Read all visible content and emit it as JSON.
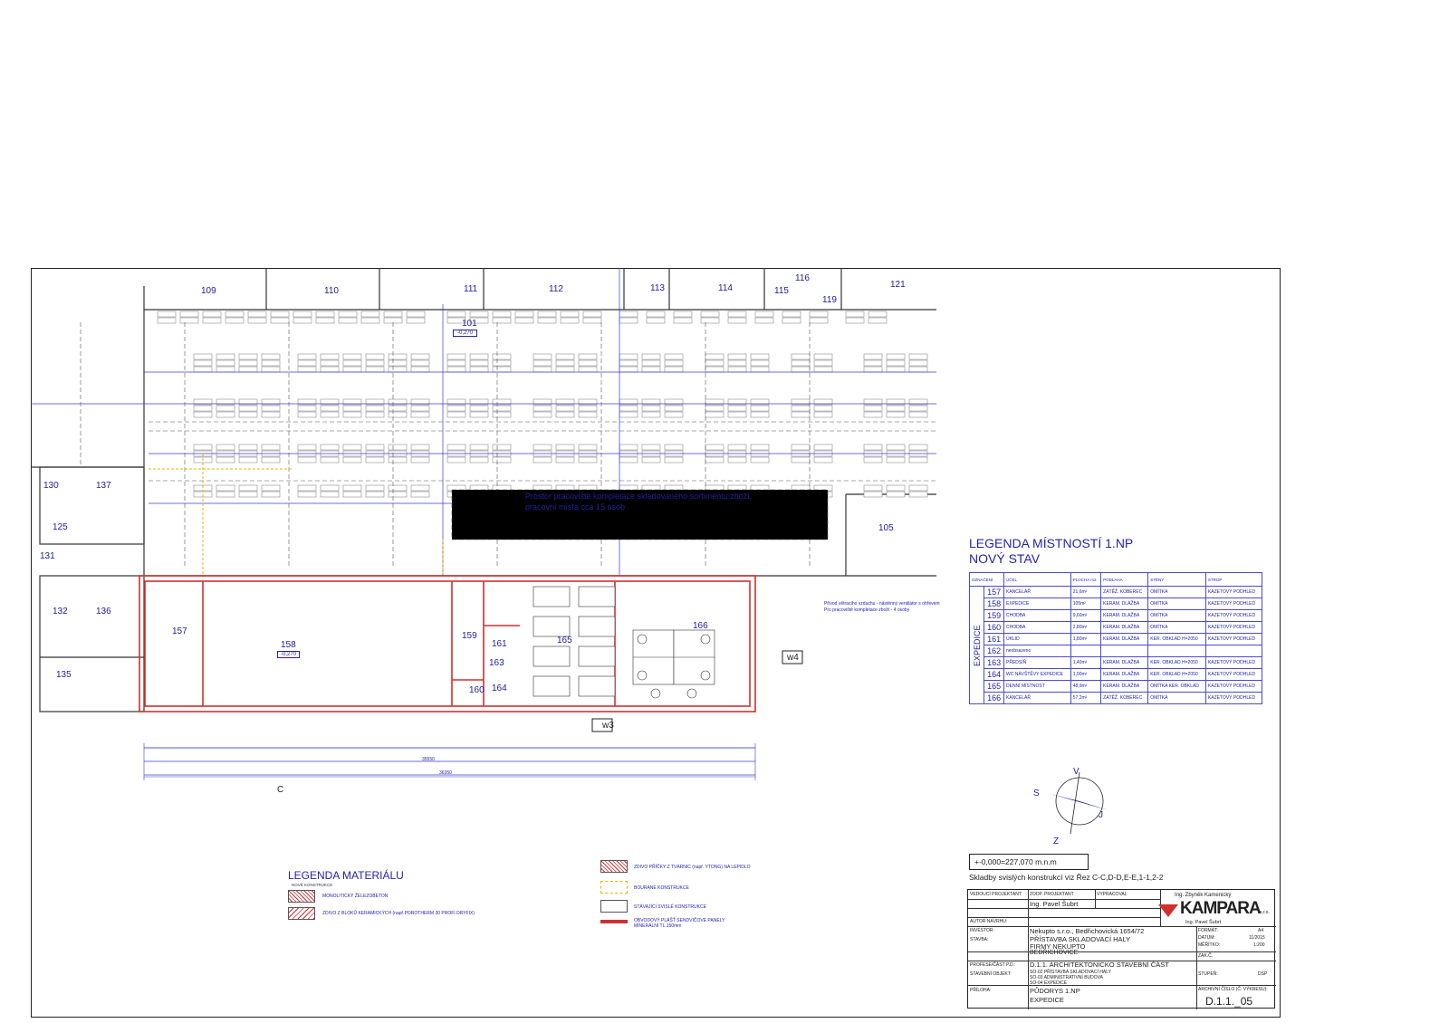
{
  "rooms_plan": [
    {
      "id": "r109",
      "label": "109"
    },
    {
      "id": "r110",
      "label": "110"
    },
    {
      "id": "r111",
      "label": "111"
    },
    {
      "id": "r112",
      "label": "112"
    },
    {
      "id": "r113",
      "label": "113"
    },
    {
      "id": "r114",
      "label": "114"
    },
    {
      "id": "r115",
      "label": "115"
    },
    {
      "id": "r116",
      "label": "116"
    },
    {
      "id": "r119",
      "label": "119"
    },
    {
      "id": "r121",
      "label": "121"
    },
    {
      "id": "r101",
      "label": "101"
    },
    {
      "id": "r105",
      "label": "105"
    },
    {
      "id": "r130",
      "label": "130"
    },
    {
      "id": "r137",
      "label": "137"
    },
    {
      "id": "r125",
      "label": "125"
    },
    {
      "id": "r131",
      "label": "131"
    },
    {
      "id": "r132",
      "label": "132"
    },
    {
      "id": "r136",
      "label": "136"
    },
    {
      "id": "r135",
      "label": "135"
    },
    {
      "id": "r157",
      "label": "157"
    },
    {
      "id": "r158",
      "label": "158"
    },
    {
      "id": "r159",
      "label": "159"
    },
    {
      "id": "r160",
      "label": "160"
    },
    {
      "id": "r161",
      "label": "161"
    },
    {
      "id": "r163",
      "label": "163"
    },
    {
      "id": "r164",
      "label": "164"
    },
    {
      "id": "r165",
      "label": "165"
    },
    {
      "id": "r166",
      "label": "166"
    }
  ],
  "plan_text": {
    "workspace_note_1": "Prostor pracoviště kompletace skladovaného sortimentu zboží,",
    "workspace_note_2": "pracovní místa cca 15 osob",
    "level_101": "-0,270",
    "level_158": "-0,270",
    "axis_c": "C",
    "tag_w3": "w3",
    "tag_w4": "w4",
    "dim_total": "36350",
    "dim_sub": "35550",
    "vent_note_1": "Přívod větracího vzduchu - nástěnný ventilátor s ohřevem",
    "vent_note_2": "Pro pracoviště kompletace zboží - 4 osoby"
  },
  "room_legend": {
    "title_1": "LEGENDA MÍSTNOSTÍ 1.NP",
    "title_2": "NOVÝ STAV",
    "headers": [
      "OZNAČENÍ",
      "ÚČEL",
      "PLOCHA m2",
      "PODLAHA",
      "STĚNY",
      "STROP"
    ],
    "group": "EXPEDICE",
    "rows": [
      {
        "num": "157",
        "use": "KANCELÁŘ",
        "area": "21,6m²",
        "floor": "ZÁTĚŽ. KOBEREC",
        "walls": "OMÍTKA",
        "ceiling": "KAZETOVÝ PODHLED"
      },
      {
        "num": "158",
        "use": "EXPEDICE",
        "area": "105m²",
        "floor": "KERAM. DLAŽBA",
        "walls": "OMÍTKA",
        "ceiling": "KAZETOVÝ PODHLED"
      },
      {
        "num": "159",
        "use": "CHODBA",
        "area": "9,60m²",
        "floor": "KERAM. DLAŽBA",
        "walls": "OMÍTKA",
        "ceiling": "KAZETOVÝ PODHLED"
      },
      {
        "num": "160",
        "use": "CHODBA",
        "area": "2,80m²",
        "floor": "KERAM. DLAŽBA",
        "walls": "OMÍTKA",
        "ceiling": "KAZETOVÝ PODHLED"
      },
      {
        "num": "161",
        "use": "ÚKLID",
        "area": "1,80m²",
        "floor": "KERAM. DLAŽBA",
        "walls": "KER. OBKLAD H=2050",
        "ceiling": "KAZETOVÝ PODHLED"
      },
      {
        "num": "162",
        "use": "neobsazeno",
        "area": "",
        "floor": "",
        "walls": "",
        "ceiling": ""
      },
      {
        "num": "163",
        "use": "PŘEDSÍŇ",
        "area": "1,40m²",
        "floor": "KERAM. DLAŽBA",
        "walls": "KER. OBKLAD H=2050",
        "ceiling": "KAZETOVÝ PODHLED"
      },
      {
        "num": "164",
        "use": "WC NÁVŠTĚVY EXPEDICE",
        "area": "1,90m²",
        "floor": "KERAM. DLAŽBA",
        "walls": "KER. OBKLAD H=2050",
        "ceiling": "KAZETOVÝ PODHLED"
      },
      {
        "num": "165",
        "use": "DENNÍ MÍSTNOST",
        "area": "48,9m²",
        "floor": "KERAM. DLAŽBA",
        "walls": "OMÍTKA KER. OBKLAD",
        "ceiling": "KAZETOVÝ PODHLED"
      },
      {
        "num": "166",
        "use": "KANCELÁŘ",
        "area": "57,2m²",
        "floor": "ZÁTĚŽ. KOBEREC",
        "walls": "OMÍTKA",
        "ceiling": "KAZETOVÝ PODHLED"
      }
    ]
  },
  "compass": {
    "n": "V",
    "s": "Z",
    "w": "S",
    "e": "J"
  },
  "elevation": "+-0,000=227,070 m.n.m",
  "sections_note": "Skladby svislých konstrukcí viz Řez C-C,D-D,E-E,1-1,2-2",
  "material_legend": {
    "title": "LEGENDA MATERIÁLU",
    "subtitle": "NOVÉ KONSTRUKCE",
    "items": [
      {
        "label": "MONOLITICKÝ ŽELEZOBETON"
      },
      {
        "label": "ZDIVO Z BLOKŮ KERAMICKÝCH (např.POROTHERM 30 PROFI DRYFIX)"
      },
      {
        "label": "ZDIVO PŘÍČKY Z TVÁRNIC (např. YTONG) NA LEPIDLO"
      },
      {
        "label": "BOURANÉ KONSTRUKCE"
      },
      {
        "label": "STÁVAJÍCÍ SVISLÉ KONSTRUKCE"
      },
      {
        "label": "OBVODOVÝ PLÁŠŤ SENDVIČOVÉ PANELY MINERÁLNÍ TL.150mm"
      }
    ]
  },
  "title_block": {
    "lead_designer": "VEDOUCÍ PROJEKTANT",
    "resp_designer": "ZODP. PROJEKTANT",
    "resp_name": "Ing. Pavel Šubrt",
    "drawn": "VYPRACOVAL",
    "author": "AUTOR NÁVRHU:",
    "investor_lbl": "INVESTOR:",
    "investor": "Nekupto s.r.o., Bedřichovická 1654/72",
    "build_lbl": "STAVBA:",
    "build_1": "PŘÍSTAVBA SKLADOVACÍ HALY",
    "build_2": "FIRMY NEKUPTO",
    "build_3": "BEDŘICHOVICE",
    "part_lbl": "PROFESE/ČÁST P.D.:",
    "part": "D.1.1. ARCHITEKTONICKO STAVEBNÍ ČÁST",
    "object_lbl": "STAVEBNÍ OBJEKT:",
    "object_1": "SO-02 PŘÍSTAVBA SKLADOVACÍ HALY",
    "object_2": "SO-03 ADMINISTRATIVNÍ BUDOVA",
    "object_3": "SO-04 EXPEDICE",
    "attach_lbl": "PŘÍLOHA:",
    "attach_1": "PŮDORYS 1.NP",
    "attach_2": "EXPEDICE",
    "format_lbl": "FORMÁT:",
    "format": "A4",
    "date_lbl": "DATUM:",
    "date": "11/2015",
    "scale_lbl": "MĚŘÍTKO:",
    "scale": "1:200",
    "order_lbl": "ZAK.Č.",
    "order": "",
    "stage_lbl": "STUPEŇ:",
    "stage": "DSP",
    "archive_lbl": "ARCHIVNÍ ČÍSLO (Č. VÝKRESU):",
    "archive": "D.1.1._05",
    "company_person": "Ing. Zbyněk Kamenický",
    "company": "KAMPARA",
    "company_suffix": "s.r.o.",
    "company_person_2": "Ing. Pavel Šubrt"
  },
  "colors": {
    "blue": "#2323b0",
    "red": "#d03030",
    "yellow": "#e8b400",
    "dark": "#222222"
  }
}
